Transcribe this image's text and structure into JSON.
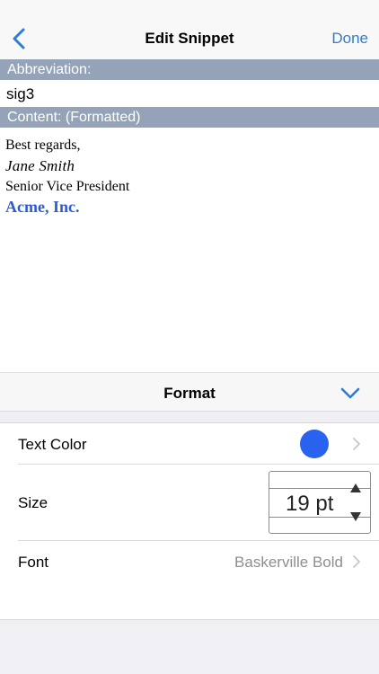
{
  "nav": {
    "title": "Edit Snippet",
    "done_label": "Done",
    "accent_color": "#2f7dd1"
  },
  "abbreviation": {
    "header": "Abbreviation:",
    "value": "sig3"
  },
  "content": {
    "header": "Content: (Formatted)",
    "lines": {
      "greeting": "Best regards,",
      "signature": "Jane Smith",
      "title": "Senior Vice President",
      "company": "Acme, Inc."
    },
    "company_color": "#2f5bd6"
  },
  "format": {
    "title": "Format",
    "text_color": {
      "label": "Text Color",
      "swatch_color": "#2a62f0"
    },
    "size": {
      "label": "Size",
      "value": "19 pt"
    },
    "font": {
      "label": "Font",
      "value": "Baskerville Bold"
    }
  },
  "icons": {
    "back": "chevron-left-icon",
    "collapse": "chevron-down-icon",
    "disclosure": "chevron-right-icon",
    "stepper_up": "triangle-up-icon",
    "stepper_down": "triangle-down-icon"
  }
}
